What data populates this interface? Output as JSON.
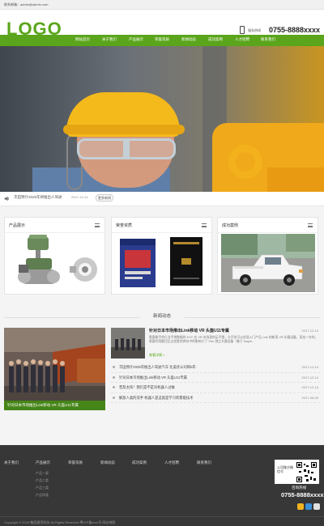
{
  "topbar": {
    "contact": "联系邮箱：admin@admin.com"
  },
  "header": {
    "logo": "LOGO",
    "hotline_label": "服务热线",
    "hotline_number": "0755-8888xxxx"
  },
  "nav": {
    "items": [
      "网站首页",
      "关于我们",
      "产品展示",
      "荣誉资质",
      "新闻动态",
      "成功案例",
      "人才招聘",
      "联系我们"
    ]
  },
  "banner": {
    "dot_count": 2,
    "active_dot": 2
  },
  "ticker": {
    "text": "丰田预计2025年将推出人驾驶",
    "date": "2017-12-14",
    "more_label": "更多新闻"
  },
  "boxes": [
    {
      "title": "产品展示"
    },
    {
      "title": "荣誉资质"
    },
    {
      "title": "成功案例"
    }
  ],
  "news": {
    "heading": "新闻动态",
    "photo_caption": "针对日本市场推出Link移动 VR 头盔U11专属",
    "featured": {
      "title": "针对日本市场推出Link移动 VR 头盔U11专属",
      "date": "2017-12-14",
      "desc": "需要能手的行业平常数据的 HTC 在 VR 市场里的足不错，与不仅可以实现入门产品 Link 的新用 VR 头戴设备，而也一年的，需要利用题目后过优胜的库存中的影响力了 Vive 独立头戴设备（基于 Daydr...",
      "more": "查看详情 »"
    },
    "list": [
      {
        "text": "丰田预计2025年推出人驾驶汽车 比美优公司和5年",
        "date": "2017-12-14"
      },
      {
        "text": "针对日本市场推出Link移动 VR 头盔U11专属",
        "date": "2017-12-14"
      },
      {
        "text": "普及太快！我们是不是对机器人过敏",
        "date": "2017-12-14"
      },
      {
        "text": "解放人类的双手 机器人是这就是学习积累能技术",
        "date": "2017-06-09"
      }
    ]
  },
  "footer": {
    "columns": [
      {
        "title": "关于我们",
        "subs": []
      },
      {
        "title": "产品展示",
        "subs": [
          "产品一类",
          "产品二类",
          "产品三类",
          "产品四类"
        ]
      },
      {
        "title": "荣誉资质",
        "subs": []
      },
      {
        "title": "新闻动态",
        "subs": []
      },
      {
        "title": "成功案例",
        "subs": []
      },
      {
        "title": "人才招聘",
        "subs": []
      },
      {
        "title": "联系我们",
        "subs": []
      }
    ],
    "qr_label": "公司微方微信号",
    "hotline_label": "咨询热线",
    "hotline_number": "0755-8888xxxx",
    "social_colors": [
      "#f2b31f",
      "#3a8fd6",
      "#e0e0e0"
    ],
    "copyright": "Copyright © 2018 集团通用科技 All Rights Reserved  粤ICP备xxxx号  网站地图"
  },
  "colors": {
    "brand_green": "#5aa51b",
    "footer_bg": "#373737"
  }
}
